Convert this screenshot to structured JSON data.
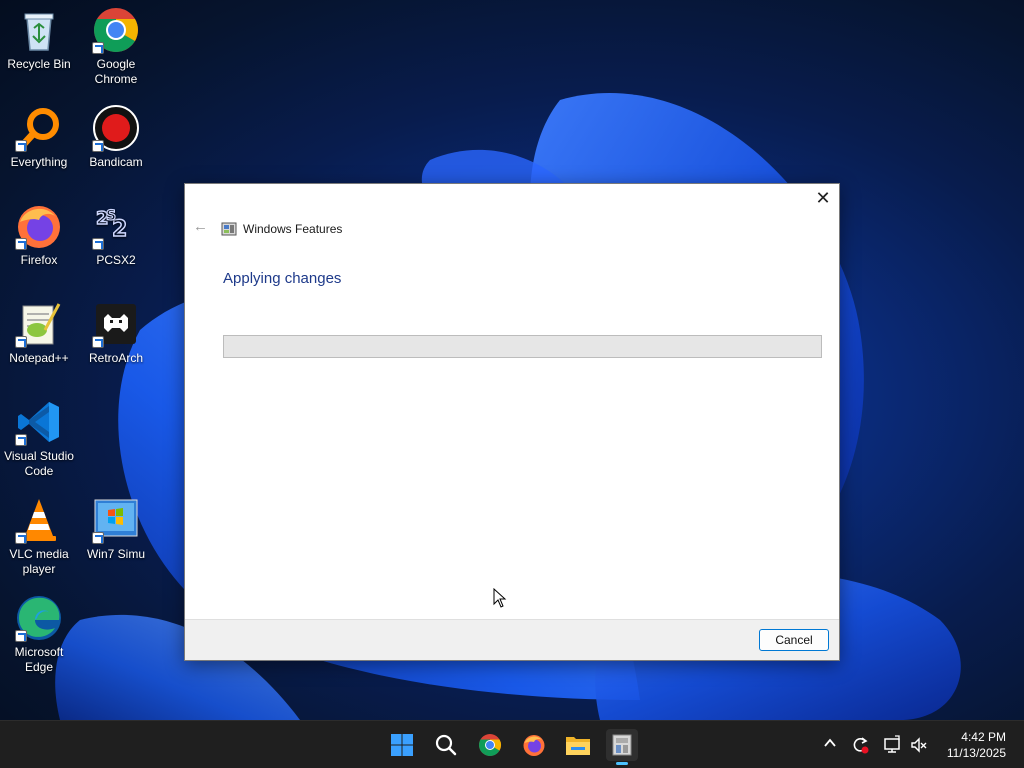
{
  "desktop": {
    "icons": [
      {
        "label": "Recycle Bin",
        "icon": "recycle-bin-icon"
      },
      {
        "label": "Google Chrome",
        "icon": "chrome-icon"
      },
      {
        "label": "Everything",
        "icon": "everything-search-icon"
      },
      {
        "label": "Bandicam",
        "icon": "bandicam-icon"
      },
      {
        "label": "Firefox",
        "icon": "firefox-icon"
      },
      {
        "label": "PCSX2",
        "icon": "pcsx2-icon"
      },
      {
        "label": "Notepad++",
        "icon": "notepadpp-icon"
      },
      {
        "label": "RetroArch",
        "icon": "retroarch-icon"
      },
      {
        "label": "Visual Studio Code",
        "icon": "vscode-icon"
      },
      {
        "label": "VLC media player",
        "icon": "vlc-icon"
      },
      {
        "label": "Win7 Simu",
        "icon": "win7-simu-icon"
      },
      {
        "label": "Microsoft Edge",
        "icon": "edge-icon"
      }
    ]
  },
  "dialog": {
    "window_title": "Windows Features",
    "heading": "Applying changes",
    "progress": 0,
    "cancel_label": "Cancel",
    "close_glyph": "✕",
    "back_glyph": "←"
  },
  "taskbar": {
    "apps": [
      "start-icon",
      "search-icon",
      "chrome-icon",
      "firefox-icon",
      "file-explorer-icon",
      "windows-features-icon"
    ],
    "clock": {
      "time": "4:42 PM",
      "date": "11/13/2025"
    },
    "tray": {
      "chevron": "^"
    }
  },
  "colors": {
    "accent": "#0078d4",
    "heading": "#1e3a8a",
    "taskbar": "#1f1f1f"
  }
}
